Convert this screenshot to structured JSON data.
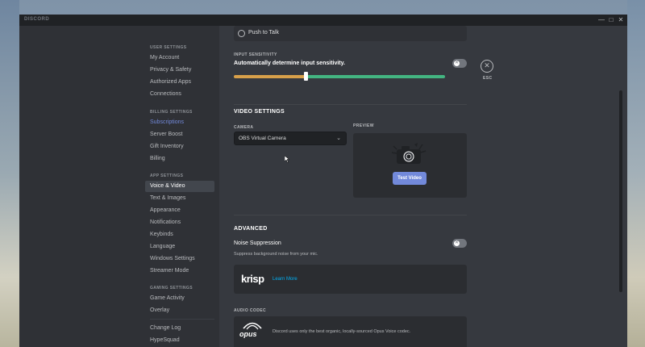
{
  "window": {
    "title": "DISCORD",
    "minimize": "—",
    "maximize": "□",
    "close": "✕"
  },
  "sidebar": {
    "user_settings_head": "USER SETTINGS",
    "user_items": [
      "My Account",
      "Privacy & Safety",
      "Authorized Apps",
      "Connections"
    ],
    "billing_head": "BILLING SETTINGS",
    "billing_items": [
      "Subscriptions",
      "Server Boost",
      "Gift Inventory",
      "Billing"
    ],
    "app_head": "APP SETTINGS",
    "app_items": [
      "Voice & Video",
      "Text & Images",
      "Appearance",
      "Notifications",
      "Keybinds",
      "Language",
      "Windows Settings",
      "Streamer Mode"
    ],
    "gaming_head": "GAMING SETTINGS",
    "gaming_items": [
      "Game Activity",
      "Overlay"
    ],
    "misc_items": [
      "Change Log",
      "HypeSquad"
    ]
  },
  "voice": {
    "push_to_talk": "Push to Talk",
    "input_sensitivity_label": "INPUT SENSITIVITY",
    "auto_sensitivity": "Automatically determine input sensitivity.",
    "auto_sensitivity_on": false,
    "sensitivity_level": 0.34
  },
  "video": {
    "heading": "VIDEO SETTINGS",
    "camera_label": "CAMERA",
    "camera_value": "OBS Virtual Camera",
    "preview_label": "PREVIEW",
    "test_button": "Test Video"
  },
  "advanced": {
    "heading": "ADVANCED",
    "noise_title": "Noise Suppression",
    "noise_desc": "Suppress background noise from your mic.",
    "noise_on": false,
    "krisp_logo": "krisp",
    "krisp_link": "Learn More",
    "codec_label": "AUDIO CODEC",
    "opus_logo": "opus",
    "codec_desc": "Discord uses only the best organic, locally-sourced Opus Voice codec."
  },
  "close": {
    "icon": "✕",
    "label": "ESC"
  },
  "colors": {
    "accent": "#7289da",
    "sens_orange": "#d8a04a",
    "sens_green": "#43b581"
  }
}
